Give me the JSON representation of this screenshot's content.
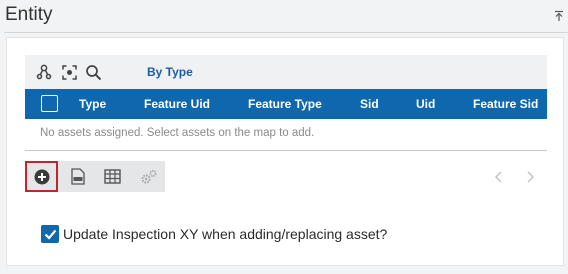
{
  "panel": {
    "title": "Entity"
  },
  "toolbar": {
    "icons": [
      "network-icon",
      "focus-icon",
      "search-icon"
    ],
    "by_type_label": "By Type"
  },
  "grid": {
    "columns": [
      "Type",
      "Feature Uid",
      "Feature Type",
      "Sid",
      "Uid",
      "Feature Sid"
    ],
    "empty_message": "No assets assigned. Select assets on the map to add."
  },
  "actions": {
    "icons": [
      "add-icon",
      "export-csv-icon",
      "table-icon",
      "settings-gears-icon"
    ]
  },
  "pager": {
    "prev": "‹",
    "next": "›"
  },
  "option": {
    "checked": true,
    "label": "Update Inspection XY when adding/replacing asset?"
  },
  "colors": {
    "accent": "#0f67ad",
    "selected_border": "#c0272d"
  }
}
